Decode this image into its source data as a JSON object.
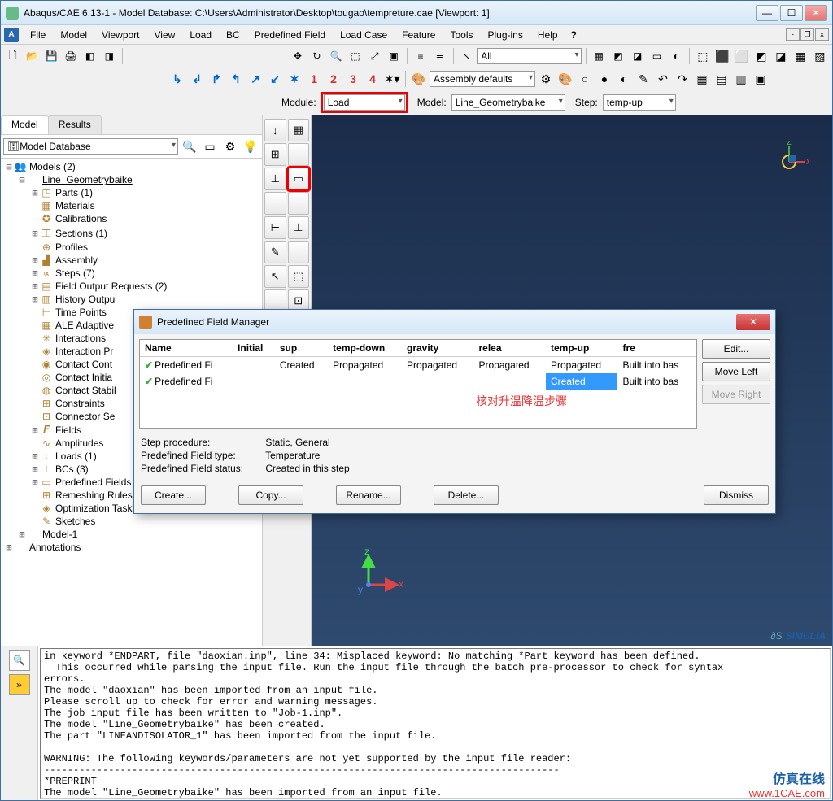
{
  "window": {
    "title": "Abaqus/CAE 6.13-1 - Model Database: C:\\Users\\Administrator\\Desktop\\tougao\\tempreture.cae [Viewport: 1]"
  },
  "menu": {
    "items": [
      "File",
      "Model",
      "Viewport",
      "View",
      "Load",
      "BC",
      "Predefined Field",
      "Load Case",
      "Feature",
      "Tools",
      "Plug-ins",
      "Help"
    ],
    "help_icon": "?"
  },
  "toolbar_icons": {
    "new": "🗋",
    "open": "📂",
    "save": "💾",
    "print": "🖨",
    "cube1": "◧",
    "cube2": "◨",
    "pan": "✥",
    "rotate": "↻",
    "zoom": "🔍",
    "boxzoom": "⬚",
    "fit": "⤢",
    "autofit": "▣",
    "lines1": "≡",
    "lines2": "≣",
    "arrow": "↖",
    "wire": "▦",
    "shade1": "◩",
    "shade2": "◪",
    "persp": "▭",
    "light": "◐",
    "cubes": [
      "⬚",
      "⬛",
      "⬜",
      "◩",
      "◪",
      "▦",
      "▨"
    ],
    "cs_x": "x",
    "cs_y": "y",
    "cs_z": "z",
    "cs_123": "⊹",
    "more": [
      "⚙",
      "🎨",
      "○",
      "●",
      "◐",
      "✎",
      "↶",
      "↷",
      "▦",
      "▤",
      "▥",
      "▣"
    ]
  },
  "context": {
    "module_label": "Module:",
    "module_value": "Load",
    "model_label": "Model:",
    "model_value": "Line_Geometrybaike",
    "step_label": "Step:",
    "step_value": "temp-up",
    "all_value": "All",
    "asm_value": "Assembly defaults"
  },
  "tabs": {
    "model": "Model",
    "results": "Results"
  },
  "tree_dd": "Model Database",
  "tree": [
    {
      "lvl": 1,
      "exp": "-",
      "icon": "👥",
      "label": "Models (2)"
    },
    {
      "lvl": 2,
      "exp": "-",
      "icon": "",
      "label": "Line_Geometrybaike",
      "linked": true
    },
    {
      "lvl": 3,
      "exp": "+",
      "icon": "◳",
      "label": "Parts (1)"
    },
    {
      "lvl": 3,
      "exp": "",
      "icon": "▦",
      "label": "Materials"
    },
    {
      "lvl": 3,
      "exp": "",
      "icon": "✪",
      "label": "Calibrations"
    },
    {
      "lvl": 3,
      "exp": "+",
      "icon": "工",
      "label": "Sections (1)"
    },
    {
      "lvl": 3,
      "exp": "",
      "icon": "⊕",
      "label": "Profiles"
    },
    {
      "lvl": 3,
      "exp": "+",
      "icon": "▟",
      "label": "Assembly"
    },
    {
      "lvl": 3,
      "exp": "+",
      "icon": "∝",
      "label": "Steps (7)"
    },
    {
      "lvl": 3,
      "exp": "+",
      "icon": "▤",
      "label": "Field Output Requests (2)"
    },
    {
      "lvl": 3,
      "exp": "+",
      "icon": "▥",
      "label": "History Outpu"
    },
    {
      "lvl": 3,
      "exp": "",
      "icon": "⊢",
      "label": "Time Points"
    },
    {
      "lvl": 3,
      "exp": "",
      "icon": "▦",
      "label": "ALE Adaptive"
    },
    {
      "lvl": 3,
      "exp": "",
      "icon": "✳",
      "label": "Interactions"
    },
    {
      "lvl": 3,
      "exp": "",
      "icon": "◈",
      "label": "Interaction Pr"
    },
    {
      "lvl": 3,
      "exp": "",
      "icon": "◉",
      "label": "Contact Cont"
    },
    {
      "lvl": 3,
      "exp": "",
      "icon": "◎",
      "label": "Contact Initia"
    },
    {
      "lvl": 3,
      "exp": "",
      "icon": "◍",
      "label": "Contact Stabil"
    },
    {
      "lvl": 3,
      "exp": "",
      "icon": "⊞",
      "label": "Constraints"
    },
    {
      "lvl": 3,
      "exp": "",
      "icon": "⊡",
      "label": "Connector Se"
    },
    {
      "lvl": 3,
      "exp": "+",
      "icon": "𝑭",
      "label": "Fields"
    },
    {
      "lvl": 3,
      "exp": "",
      "icon": "∿",
      "label": "Amplitudes"
    },
    {
      "lvl": 3,
      "exp": "+",
      "icon": "↓",
      "label": "Loads (1)"
    },
    {
      "lvl": 3,
      "exp": "+",
      "icon": "⊥",
      "label": "BCs (3)"
    },
    {
      "lvl": 3,
      "exp": "+",
      "icon": "▭",
      "label": "Predefined Fields (2)"
    },
    {
      "lvl": 3,
      "exp": "",
      "icon": "⊞",
      "label": "Remeshing Rules"
    },
    {
      "lvl": 3,
      "exp": "",
      "icon": "◈",
      "label": "Optimization Tasks"
    },
    {
      "lvl": 3,
      "exp": "",
      "icon": "✎",
      "label": "Sketches"
    },
    {
      "lvl": 2,
      "exp": "+",
      "icon": "",
      "label": "Model-1"
    },
    {
      "lvl": 1,
      "exp": "+",
      "icon": "",
      "label": "Annotations"
    }
  ],
  "toolbox": [
    "↓",
    "▦",
    "⊞",
    "",
    "⊥",
    "▭",
    "",
    "",
    "⊢",
    "⊥",
    "✎",
    "",
    "↖",
    "⬚",
    "",
    "⊡"
  ],
  "triad_labels": {
    "x": "x",
    "y": "y",
    "z": "z"
  },
  "watermark": "1CAE . COM",
  "simulia": "SIMULIA",
  "annot1": "核对升温降温步骤",
  "dialog": {
    "title": "Predefined Field Manager",
    "columns": [
      "Name",
      "Initial",
      "sup",
      "temp-down",
      "gravity",
      "relea",
      "temp-up",
      "fre"
    ],
    "rows": [
      {
        "name": "Predefined Fi",
        "vals": [
          "",
          "Created",
          "Propagated",
          "Propagated",
          "Propagated",
          "Propagated",
          "Built into bas"
        ]
      },
      {
        "name": "Predefined Fi",
        "vals": [
          "",
          "",
          "",
          "",
          "",
          "Created",
          "Built into bas"
        ],
        "sel": 5
      }
    ],
    "sidebtns": [
      "Edit...",
      "Move Left",
      "Move Right"
    ],
    "info": [
      [
        "Step procedure:",
        "Static, General"
      ],
      [
        "Predefined Field type:",
        "Temperature"
      ],
      [
        "Predefined Field status:",
        "Created in this step"
      ]
    ],
    "footer_left": [
      "Create...",
      "Copy...",
      "Rename...",
      "Delete..."
    ],
    "footer_right": "Dismiss"
  },
  "msglog": "in keyword *ENDPART, file \"daoxian.inp\", line 34: Misplaced keyword: No matching *Part keyword has been defined.\n  This occurred while parsing the input file. Run the input file through the batch pre-processor to check for syntax\nerrors.\nThe model \"daoxian\" has been imported from an input file.\nPlease scroll up to check for error and warning messages.\nThe job input file has been written to \"Job-1.inp\".\nThe model \"Line_Geometrybaike\" has been created.\nThe part \"LINEANDISOLATOR_1\" has been imported from the input file.\n\nWARNING: The following keywords/parameters are not yet supported by the input file reader:\n----------------------------------------------------------------------------------------\n*PREPRINT\nThe model \"Line_Geometrybaike\" has been imported from an input file.\nPlease scroll up to check for error and warning messages.\n",
  "footmark": {
    "cn": "仿真在线",
    "url": "www.1CAE.com"
  }
}
